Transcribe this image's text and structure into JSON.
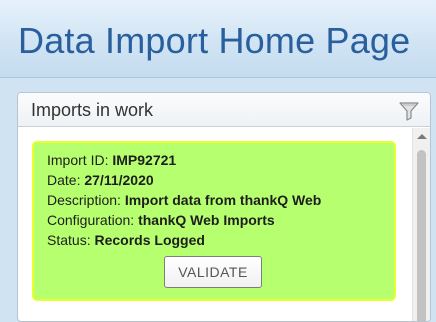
{
  "page": {
    "title": "Data Import Home Page"
  },
  "panel": {
    "title": "Imports in work",
    "filter_icon": "filter-icon"
  },
  "import_card": {
    "color": "#b6ff6e",
    "border_color": "#e8ff2e",
    "fields": [
      {
        "label": "Import ID:",
        "value": "IMP92721"
      },
      {
        "label": "Date:",
        "value": "27/11/2020"
      },
      {
        "label": "Description:",
        "value": "Import data from thankQ Web"
      },
      {
        "label": "Configuration:",
        "value": "thankQ Web Imports"
      },
      {
        "label": "Status:",
        "value": "Records Logged"
      }
    ],
    "button_label": "VALIDATE"
  }
}
